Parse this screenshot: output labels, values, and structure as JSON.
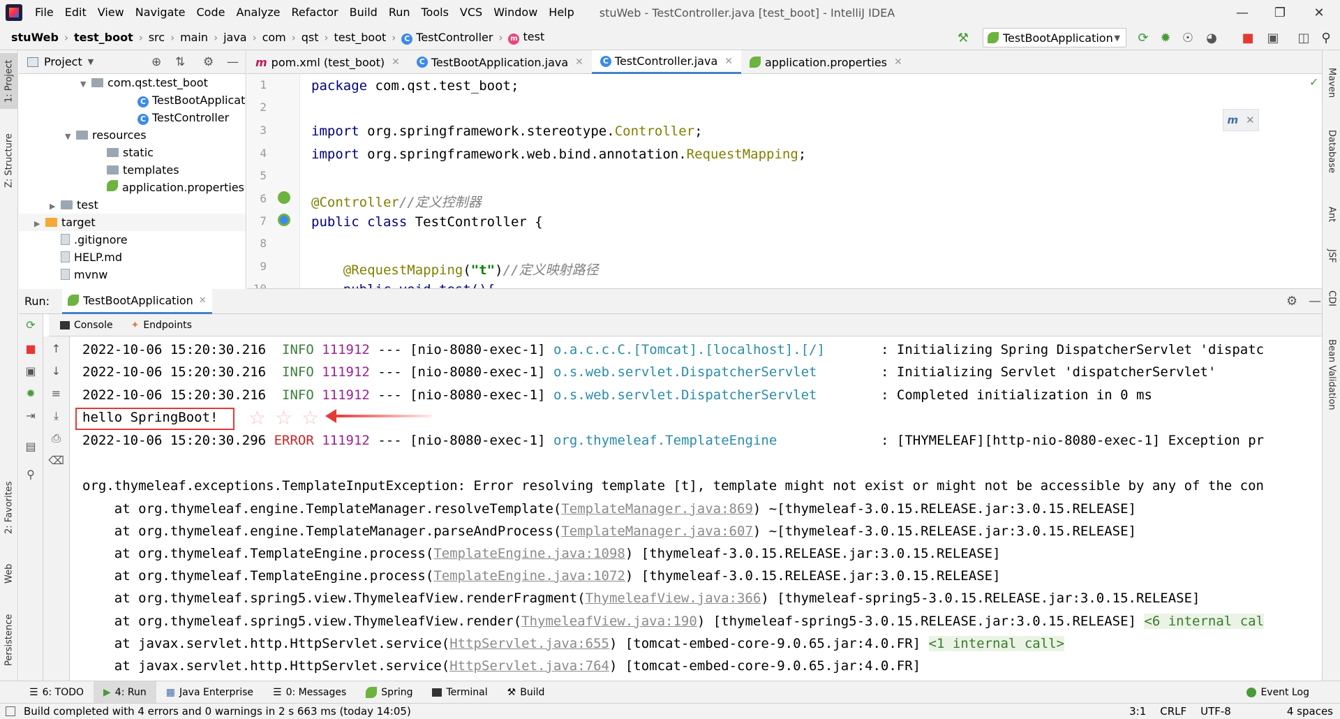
{
  "menubar": {
    "items": [
      "File",
      "Edit",
      "View",
      "Navigate",
      "Code",
      "Analyze",
      "Refactor",
      "Build",
      "Run",
      "Tools",
      "VCS",
      "Window",
      "Help"
    ],
    "window_title": "stuWeb - TestController.java [test_boot] - IntelliJ IDEA"
  },
  "navbar": {
    "crumbs": [
      "stuWeb",
      "test_boot",
      "src",
      "main",
      "java",
      "com",
      "qst",
      "test_boot",
      "TestController",
      "test"
    ],
    "run_config": "TestBootApplication"
  },
  "left_strip": {
    "project": "1: Project",
    "structure": "Z: Structure",
    "favorites": "2: Favorites",
    "web": "Web",
    "persistence": "Persistence"
  },
  "right_strip": {
    "maven": "Maven",
    "database": "Database",
    "ant": "Ant",
    "jsf": "JSF",
    "cdi": "CDI",
    "bean_validation": "Bean Validation"
  },
  "project_panel": {
    "title": "Project",
    "tree": [
      {
        "label": "com.qst.test_boot",
        "kind": "package",
        "indent": 4,
        "expanded": true
      },
      {
        "label": "TestBootApplicatio",
        "kind": "class",
        "indent": 7
      },
      {
        "label": "TestController",
        "kind": "class",
        "indent": 7
      },
      {
        "label": "resources",
        "kind": "folder",
        "indent": 3,
        "expanded": true
      },
      {
        "label": "static",
        "kind": "folder",
        "indent": 5
      },
      {
        "label": "templates",
        "kind": "folder",
        "indent": 5
      },
      {
        "label": "application.properties",
        "kind": "props",
        "indent": 5
      },
      {
        "label": "test",
        "kind": "folder",
        "indent": 2,
        "collapsed": true
      },
      {
        "label": "target",
        "kind": "folder-orange",
        "indent": 1,
        "collapsed": true
      },
      {
        "label": ".gitignore",
        "kind": "file",
        "indent": 2
      },
      {
        "label": "HELP.md",
        "kind": "file",
        "indent": 2
      },
      {
        "label": "mvnw",
        "kind": "file",
        "indent": 2
      }
    ]
  },
  "editor_tabs": [
    {
      "label": "pom.xml (test_boot)",
      "icon": "maven-icon"
    },
    {
      "label": "TestBootApplication.java",
      "icon": "class-icon"
    },
    {
      "label": "TestController.java",
      "icon": "class-icon",
      "active": true
    },
    {
      "label": "application.properties",
      "icon": "props-icon"
    }
  ],
  "editor": {
    "line_numbers": [
      "1",
      "2",
      "3",
      "4",
      "5",
      "6",
      "7",
      "8",
      "9",
      "10"
    ],
    "lines": {
      "l1_kw": "package",
      "l1_rest": " com.qst.test_boot;",
      "l3_kw": "import",
      "l3_pkg": " org.springframework.stereotype.",
      "l3_cls": "Controller",
      "l3_end": ";",
      "l4_kw": "import",
      "l4_pkg": " org.springframework.web.bind.annotation.",
      "l4_cls": "RequestMapping",
      "l4_end": ";",
      "l6_ann": "@Controller",
      "l6_cmt": "//定义控制器",
      "l7_kw": "public class",
      "l7_rest": " TestController {",
      "l9_ann": "    @RequestMapping",
      "l9_p1": "(",
      "l9_str": "\"t\"",
      "l9_p2": ")",
      "l9_cmt": "//定义映射路径",
      "l10": "    public void test(){"
    }
  },
  "run_panel": {
    "label": "Run:",
    "tab": "TestBootApplication",
    "subtabs": [
      "Console",
      "Endpoints"
    ]
  },
  "console": {
    "log1": {
      "ts": "2022-10-06 15:20:30.216",
      "level": "INFO",
      "pid": "111912",
      "thread": "--- [nio-8080-exec-1]",
      "logger": "o.a.c.c.C.[Tomcat].[localhost].[/]",
      "msg": ": Initializing Spring DispatcherServlet 'dispatc"
    },
    "log2": {
      "ts": "2022-10-06 15:20:30.216",
      "level": "INFO",
      "pid": "111912",
      "thread": "--- [nio-8080-exec-1]",
      "logger": "o.s.web.servlet.DispatcherServlet",
      "msg": ": Initializing Servlet 'dispatcherServlet'"
    },
    "log3": {
      "ts": "2022-10-06 15:20:30.216",
      "level": "INFO",
      "pid": "111912",
      "thread": "--- [nio-8080-exec-1]",
      "logger": "o.s.web.servlet.DispatcherServlet",
      "msg": ": Completed initialization in 0 ms"
    },
    "hello": "hello SpringBoot!",
    "log4": {
      "ts": "2022-10-06 15:20:30.296",
      "level": "ERROR",
      "pid": "111912",
      "thread": "--- [nio-8080-exec-1]",
      "logger": "org.thymeleaf.TemplateEngine",
      "msg": ": [THYMELEAF][http-nio-8080-exec-1] Exception pr"
    },
    "exception": "org.thymeleaf.exceptions.TemplateInputException: Error resolving template [t], template might not exist or might not be accessible by any of the con",
    "stack": [
      {
        "pre": "    at org.thymeleaf.engine.TemplateManager.resolveTemplate(",
        "link": "TemplateManager.java:869",
        "post": ") ~[thymeleaf-3.0.15.RELEASE.jar:3.0.15.RELEASE]",
        "extra": ""
      },
      {
        "pre": "    at org.thymeleaf.engine.TemplateManager.parseAndProcess(",
        "link": "TemplateManager.java:607",
        "post": ") ~[thymeleaf-3.0.15.RELEASE.jar:3.0.15.RELEASE]",
        "extra": ""
      },
      {
        "pre": "    at org.thymeleaf.TemplateEngine.process(",
        "link": "TemplateEngine.java:1098",
        "post": ") [thymeleaf-3.0.15.RELEASE.jar:3.0.15.RELEASE]",
        "extra": ""
      },
      {
        "pre": "    at org.thymeleaf.TemplateEngine.process(",
        "link": "TemplateEngine.java:1072",
        "post": ") [thymeleaf-3.0.15.RELEASE.jar:3.0.15.RELEASE]",
        "extra": ""
      },
      {
        "pre": "    at org.thymeleaf.spring5.view.ThymeleafView.renderFragment(",
        "link": "ThymeleafView.java:366",
        "post": ") [thymeleaf-spring5-3.0.15.RELEASE.jar:3.0.15.RELEASE]",
        "extra": ""
      },
      {
        "pre": "    at org.thymeleaf.spring5.view.ThymeleafView.render(",
        "link": "ThymeleafView.java:190",
        "post": ") [thymeleaf-spring5-3.0.15.RELEASE.jar:3.0.15.RELEASE] ",
        "extra": "<6 internal cal"
      },
      {
        "pre": "    at javax.servlet.http.HttpServlet.service(",
        "link": "HttpServlet.java:655",
        "post": ") [tomcat-embed-core-9.0.65.jar:4.0.FR] ",
        "extra": "<1 internal call>"
      },
      {
        "pre": "    at javax.servlet.http.HttpServlet.service(",
        "link": "HttpServlet.java:764",
        "post": ") [tomcat-embed-core-9.0.65.jar:4.0.FR]",
        "extra": ""
      }
    ]
  },
  "bottom_tabs": [
    "6: TODO",
    "4: Run",
    "Java Enterprise",
    "0: Messages",
    "Spring",
    "Terminal",
    "Build"
  ],
  "event_log": "Event Log",
  "status": {
    "message": "Build completed with 4 errors and 0 warnings in 2 s 663 ms (today 14:05)",
    "position": "3:1",
    "line_sep": "CRLF",
    "encoding": "UTF-8",
    "indent": "4 spaces"
  }
}
